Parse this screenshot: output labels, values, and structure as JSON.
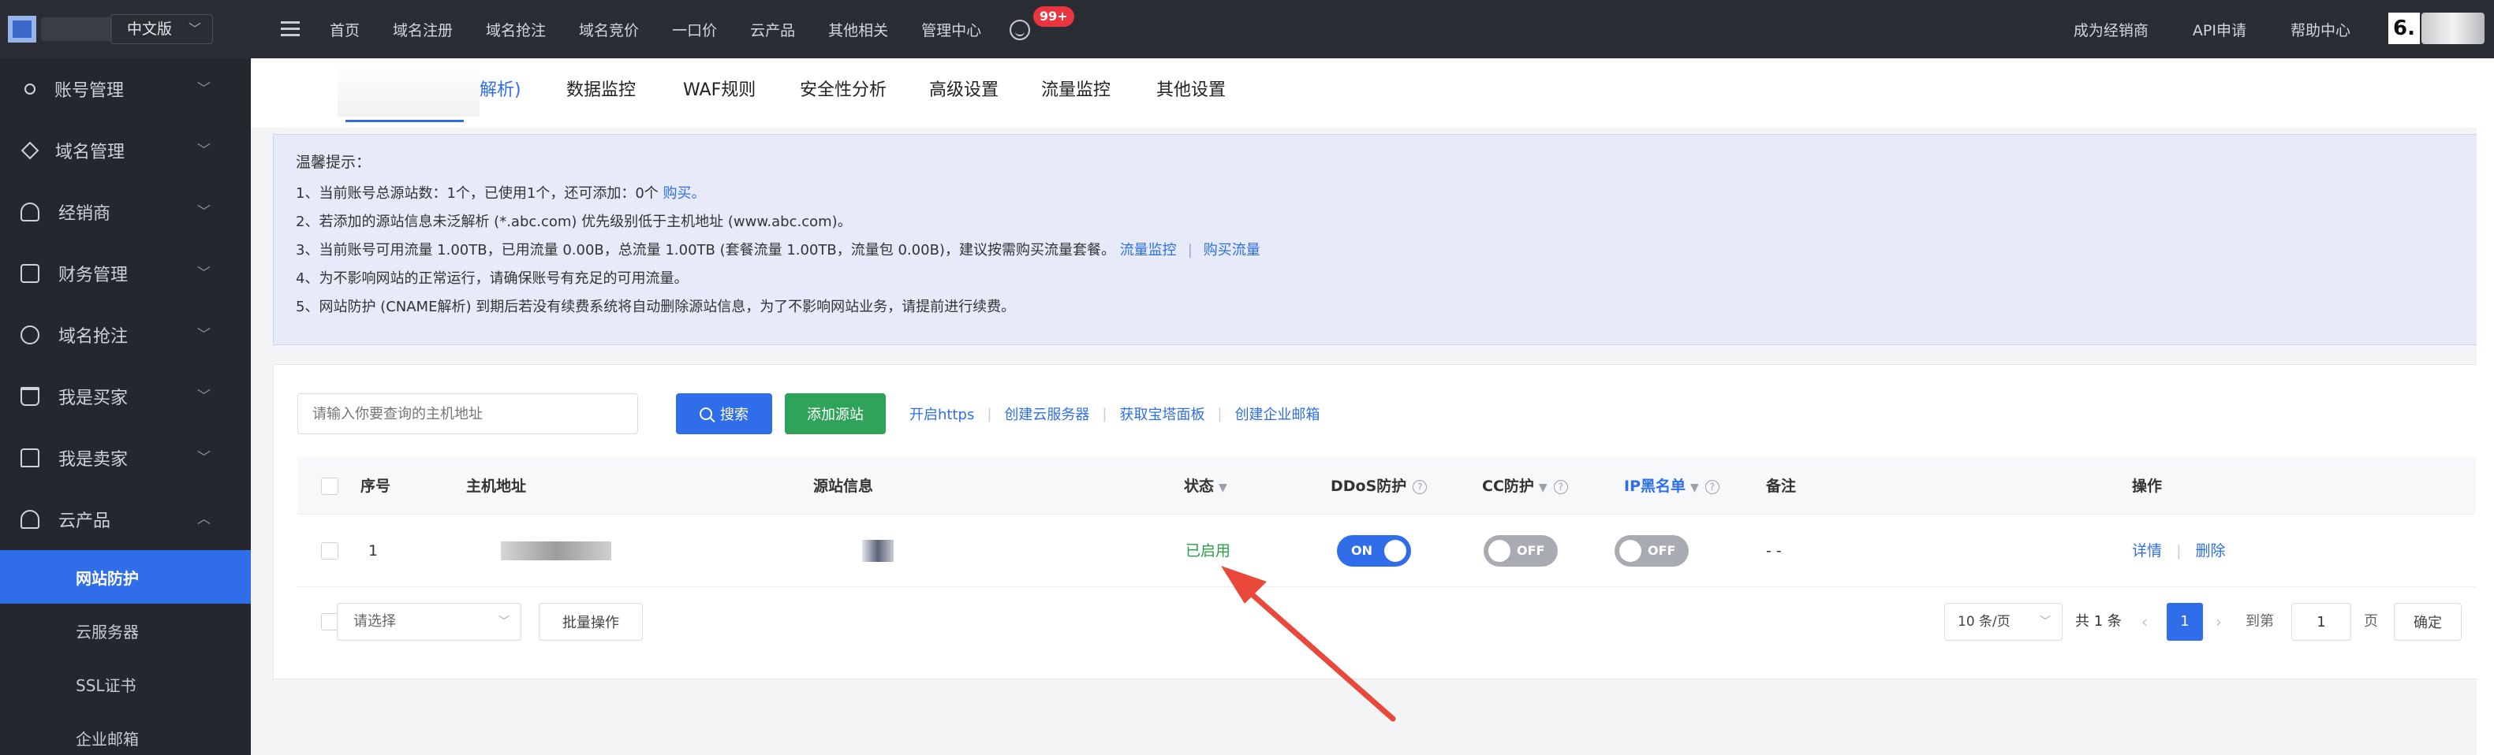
{
  "topbar": {
    "lang": "中文版",
    "nav": [
      "首页",
      "域名注册",
      "域名抢注",
      "域名竞价",
      "一口价",
      "云产品",
      "其他相关",
      "管理中心"
    ],
    "badge": "99+",
    "right_nav": [
      "成为经销商",
      "API申请",
      "帮助中心"
    ],
    "avatar_text": "6."
  },
  "sidebar": {
    "items": [
      {
        "label": "账号管理",
        "icon": "person-icon"
      },
      {
        "label": "域名管理",
        "icon": "layers-icon"
      },
      {
        "label": "经销商",
        "icon": "people-icon"
      },
      {
        "label": "财务管理",
        "icon": "wallet-icon"
      },
      {
        "label": "域名抢注",
        "icon": "clock-icon"
      },
      {
        "label": "我是买家",
        "icon": "cart-icon"
      },
      {
        "label": "我是卖家",
        "icon": "store-icon"
      },
      {
        "label": "云产品",
        "icon": "cloud-icon"
      }
    ],
    "subitems": [
      "网站防护",
      "云服务器",
      "SSL证书",
      "企业邮箱"
    ],
    "active_sub": "网站防护"
  },
  "tabs": [
    "解析)",
    "数据监控",
    "WAF规则",
    "安全性分析",
    "高级设置",
    "流量监控",
    "其他设置"
  ],
  "notice": {
    "title": "温馨提示：",
    "line1": "1、当前账号总源站数：1个，已使用1个，还可添加：0个",
    "line1_link": "购买。",
    "line2": "2、若添加的源站信息未泛解析 (*.abc.com) 优先级别低于主机地址 (www.abc.com)。",
    "line3": "3、当前账号可用流量 1.00TB，已用流量 0.00B，总流量 1.00TB (套餐流量 1.00TB，流量包 0.00B)，建议按需购买流量套餐。",
    "line3_link1": "流量监控",
    "line3_link2": "购买流量",
    "line4": "4、为不影响网站的正常运行，请确保账号有充足的可用流量。",
    "line5": "5、网站防护 (CNAME解析) 到期后若没有续费系统将自动删除源站信息，为了不影响网站业务，请提前进行续费。"
  },
  "toolbar": {
    "search_placeholder": "请输入你要查询的主机地址",
    "search_label": "搜索",
    "add_label": "添加源站",
    "links": [
      "开启https",
      "创建云服务器",
      "获取宝塔面板",
      "创建企业邮箱"
    ]
  },
  "table": {
    "headers": {
      "index": "序号",
      "host": "主机地址",
      "source": "源站信息",
      "status": "状态",
      "ddos": "DDoS防护",
      "cc": "CC防护",
      "ip": "IP黑名单",
      "note": "备注",
      "ops": "操作"
    },
    "rows": [
      {
        "index": "1",
        "status": "已启用",
        "ddos": "ON",
        "cc": "OFF",
        "ip": "OFF",
        "note": "- -",
        "op_detail": "详情",
        "op_delete": "删除"
      }
    ]
  },
  "footer": {
    "select_placeholder": "请选择",
    "batch_label": "批量操作",
    "page_size": "10 条/页",
    "total": "共 1 条",
    "current_page": "1",
    "goto_prefix": "到第",
    "goto_value": "1",
    "goto_suffix": "页",
    "confirm_label": "确定"
  },
  "colors": {
    "accent": "#2f6ee8",
    "success": "#2b9e48",
    "danger": "#e9353d",
    "annotation_arrow": "#e8493a"
  }
}
